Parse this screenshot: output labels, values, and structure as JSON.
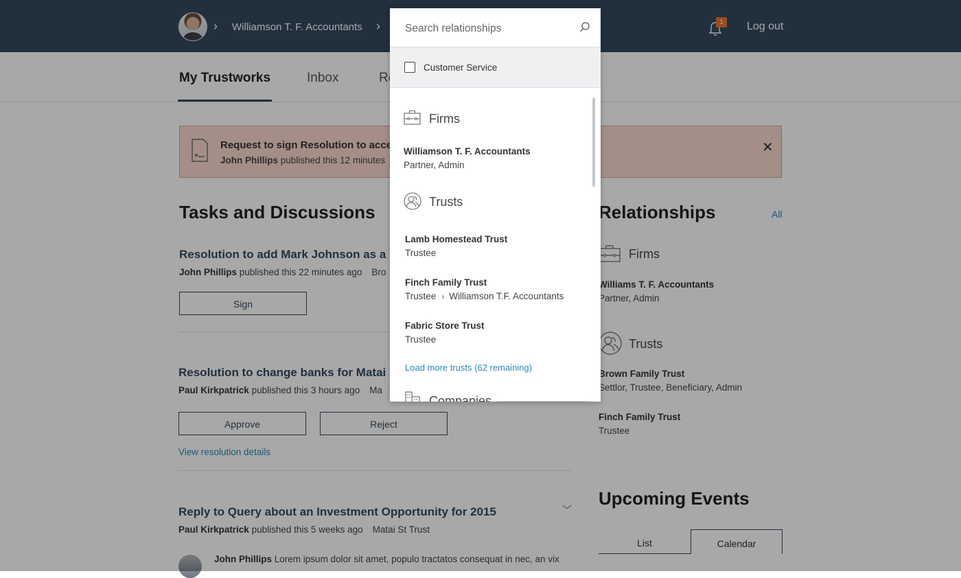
{
  "header": {
    "breadcrumb": "Williamson T. F. Accountants",
    "notification_count": "1",
    "logout_label": "Log out"
  },
  "nav": {
    "tabs": [
      {
        "label": "My Trustworks"
      },
      {
        "label": "Inbox"
      },
      {
        "label": "Re"
      }
    ]
  },
  "alert": {
    "title": "Request to sign Resolution to acce",
    "author": "John Phillips",
    "meta": "published this 12 minutes"
  },
  "tasks": {
    "heading": "Tasks and Discussions",
    "items": [
      {
        "title": "Resolution to add Mark Johnson as a",
        "author": "John Phillips",
        "meta": "published this 22 minutes ago",
        "context": "Bro",
        "buttons": [
          "Sign"
        ]
      },
      {
        "title": "Resolution to change banks for Matai",
        "author": "Paul Kirkpatrick",
        "meta": "published this 3 hours ago",
        "context": "Ma",
        "buttons": [
          "Approve",
          "Reject"
        ],
        "link": "View resolution details"
      },
      {
        "title": "Reply to Query about an Investment Opportunity for 2015",
        "author": "Paul Kirkpatrick",
        "meta": "published this 5 weeks ago",
        "context": "Matai St Trust"
      }
    ],
    "comment": {
      "author": "John Phillips",
      "text": "Lorem ipsum dolor sit amet, populo tractatos consequat in nec, an vix"
    }
  },
  "relationships": {
    "heading": "Relationships",
    "all_label": "All",
    "firms_label": "Firms",
    "firms": [
      {
        "name": "Williams T. F. Accountants",
        "role": "Partner, Admin"
      }
    ],
    "trusts_label": "Trusts",
    "trusts": [
      {
        "name": "Brown Family Trust",
        "role": "Settlor, Trustee, Beneficiary, Admin"
      },
      {
        "name": "Finch Family Trust",
        "role": "Trustee"
      }
    ]
  },
  "events": {
    "heading": "Upcoming Events",
    "views": [
      "List",
      "Calendar"
    ],
    "selected_view": "Calendar"
  },
  "search_dropdown": {
    "placeholder": "Search relationships",
    "value": "",
    "filter_label": "Customer Service",
    "filter_checked": false,
    "firms_label": "Firms",
    "firms": [
      {
        "name": "Williamson T. F. Accountants",
        "role": "Partner, Admin"
      }
    ],
    "trusts_label": "Trusts",
    "trusts": [
      {
        "name": "Lamb Homestead Trust",
        "role": "Trustee"
      },
      {
        "name": "Finch Family Trust",
        "role": "Trustee",
        "via": "Williamson T.F. Accountants"
      },
      {
        "name": "Fabric Store Trust",
        "role": "Trustee"
      }
    ],
    "load_more_label": "Load more trusts (62 remaining)",
    "companies_label": "Companies"
  },
  "colors": {
    "header_bg": "#34495e",
    "accent": "#2e86b8",
    "alert_bg": "#f7d9cf",
    "badge": "#e8762b"
  }
}
